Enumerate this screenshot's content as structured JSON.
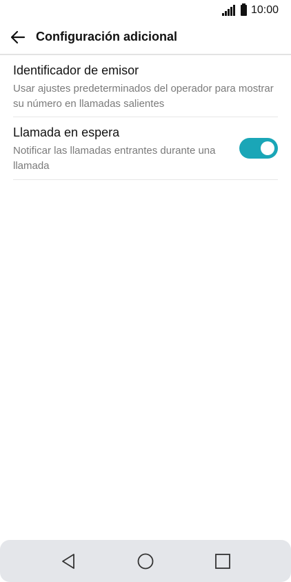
{
  "status_bar": {
    "time": "10:00",
    "icons": [
      "signal-icon",
      "battery-icon"
    ]
  },
  "header": {
    "back_icon": "arrow-left-icon",
    "title": "Configuración adicional"
  },
  "settings": [
    {
      "title": "Identificador de emisor",
      "summary": "Usar ajustes predeterminados del operador para mostrar su número en llamadas salientes",
      "has_toggle": false
    },
    {
      "title": "Llamada en espera",
      "summary": "Notificar las llamadas entrantes durante una llamada",
      "has_toggle": true,
      "toggle_on": true
    }
  ],
  "nav_bar": {
    "buttons": [
      "back-triangle-icon",
      "home-circle-icon",
      "recents-square-icon"
    ]
  },
  "colors": {
    "accent": "#1aa6b7",
    "summary_text": "#7a7a7a",
    "nav_background": "#e4e6ea"
  }
}
